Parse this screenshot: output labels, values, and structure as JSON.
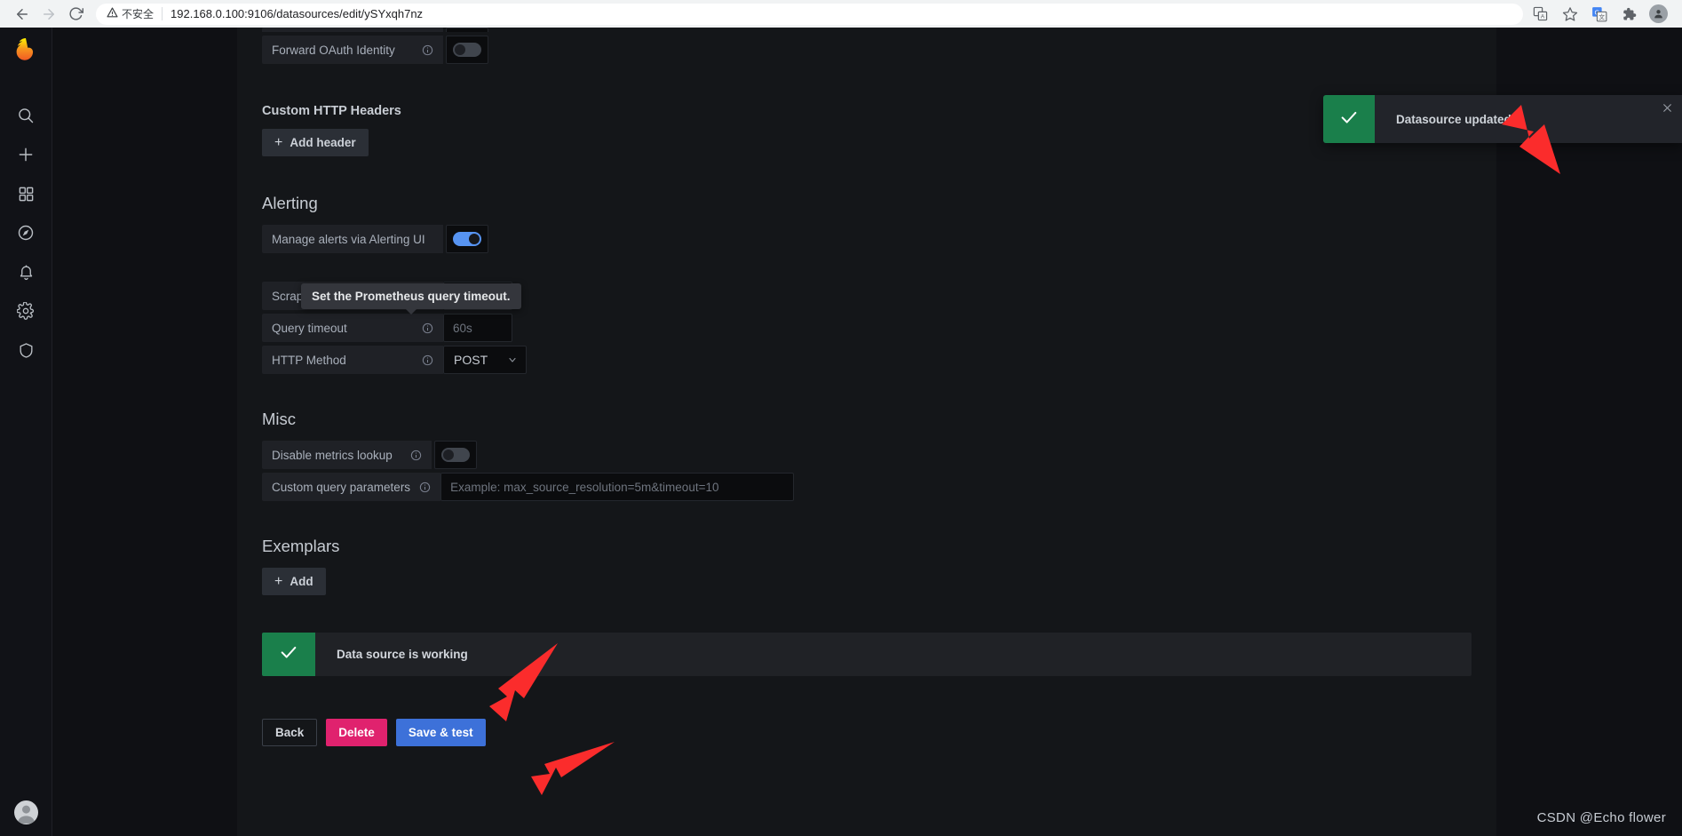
{
  "browser": {
    "back_icon": "back-arrow-icon",
    "forward_icon": "forward-arrow-icon",
    "reload_icon": "reload-icon",
    "security_label": "不安全",
    "url": "192.168.0.100:9106/datasources/edit/ySYxqh7nz",
    "toolbar_icons": [
      "translate-page-icon",
      "bookmark-star-icon",
      "google-translate-icon",
      "extensions-puzzle-icon",
      "profile-avatar-icon"
    ]
  },
  "sidebar": {
    "logo": "grafana-logo-icon",
    "items": [
      {
        "name": "search-icon",
        "label": "Search"
      },
      {
        "name": "create-plus-icon",
        "label": "Create"
      },
      {
        "name": "dashboards-grid-icon",
        "label": "Dashboards"
      },
      {
        "name": "explore-compass-icon",
        "label": "Explore"
      },
      {
        "name": "alerting-bell-icon",
        "label": "Alerting"
      },
      {
        "name": "configuration-gear-icon",
        "label": "Configuration"
      },
      {
        "name": "server-admin-shield-icon",
        "label": "Server Admin"
      }
    ],
    "avatar": "user-avatar-icon"
  },
  "form": {
    "forward_oauth": {
      "label": "Forward OAuth Identity",
      "toggle_state": "off"
    },
    "custom_http_headers": {
      "heading": "Custom HTTP Headers",
      "add_button": "Add header",
      "add_icon": "plus-icon"
    },
    "alerting": {
      "heading": "Alerting",
      "manage_alerts_label": "Manage alerts via Alerting UI",
      "toggle_state": "on"
    },
    "scrape_interval": {
      "label": "Scrape interval"
    },
    "query_timeout": {
      "label": "Query timeout",
      "value": "",
      "placeholder": "60s"
    },
    "http_method": {
      "label": "HTTP Method",
      "value": "POST",
      "chevron": "chevron-down-icon"
    },
    "tooltip": {
      "text": "Set the Prometheus query timeout."
    },
    "misc": {
      "heading": "Misc",
      "disable_metrics_lookup_label": "Disable metrics lookup",
      "disable_metrics_lookup_state": "off",
      "custom_query_parameters_label": "Custom query parameters",
      "custom_query_parameters_value": "",
      "custom_query_parameters_placeholder": "Example: max_source_resolution=5m&timeout=10"
    },
    "exemplars": {
      "heading": "Exemplars",
      "add_button": "Add",
      "add_icon": "plus-icon"
    },
    "status_banner": {
      "icon": "check-icon",
      "text": "Data source is working",
      "color": "#1a7f4b"
    },
    "actions": {
      "back": "Back",
      "delete": "Delete",
      "save_and_test": "Save & test",
      "delete_color": "#e0226e",
      "primary_color": "#3d71d9"
    }
  },
  "toast": {
    "icon": "check-icon",
    "message": "Datasource updated",
    "close_icon": "close-icon",
    "color": "#1a7f4b"
  },
  "watermark": {
    "text": "CSDN @Echo flower"
  }
}
